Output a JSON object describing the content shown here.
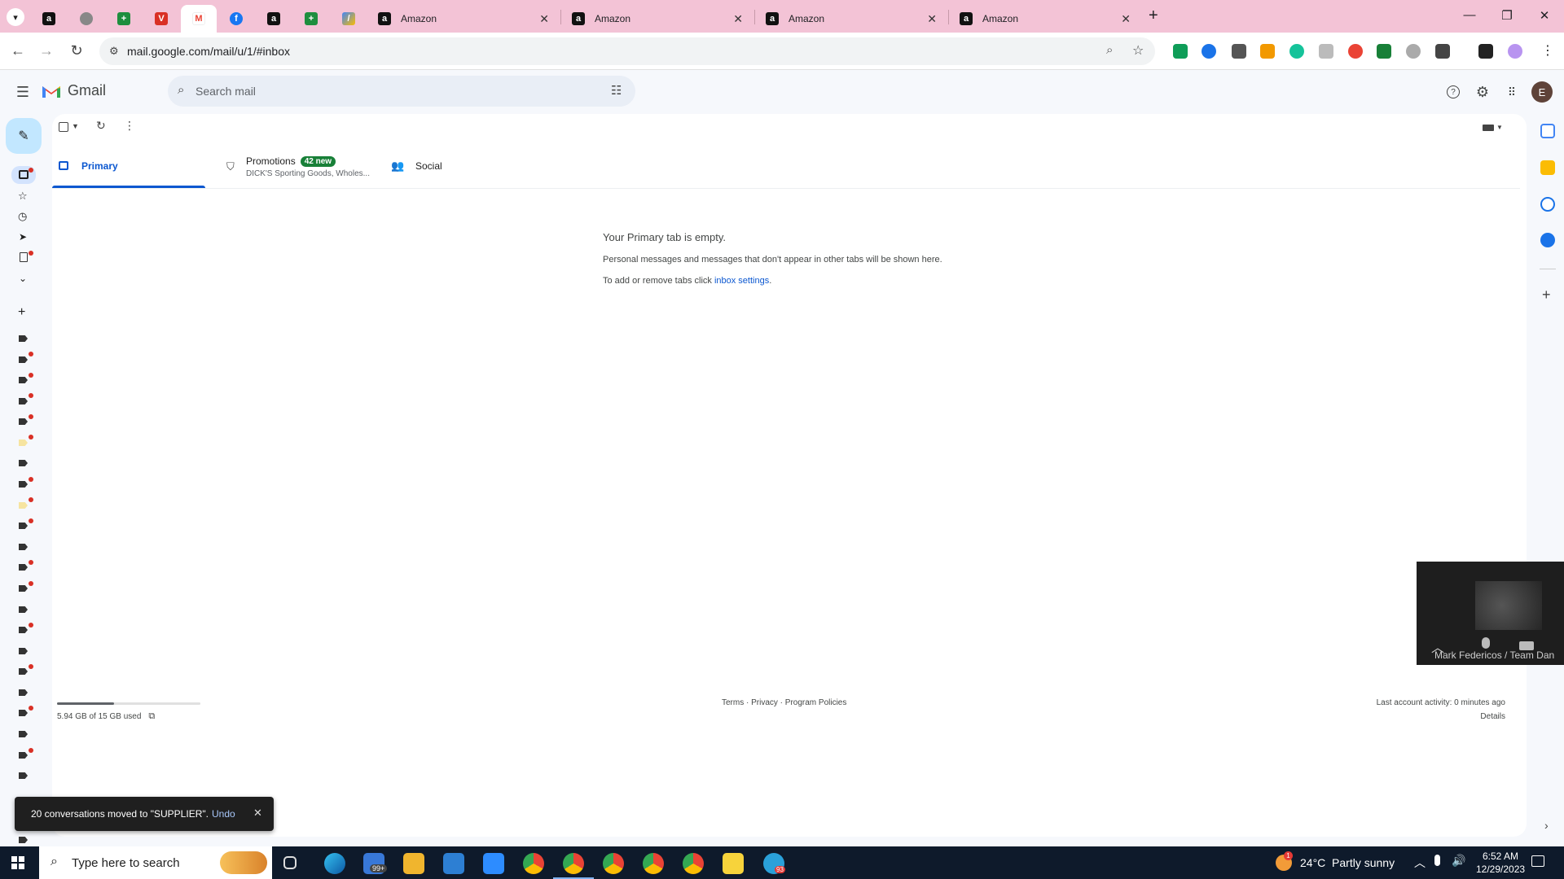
{
  "browser": {
    "tabs": [
      {
        "label": "Amazon"
      },
      {
        "label": "Amazon"
      },
      {
        "label": "Amazon"
      },
      {
        "label": "Amazon"
      }
    ],
    "url": "mail.google.com/mail/u/1/#inbox"
  },
  "header": {
    "app_name": "Gmail",
    "search_placeholder": "Search mail",
    "avatar_letter": "E"
  },
  "category_tabs": [
    {
      "label": "Primary"
    },
    {
      "label": "Promotions",
      "badge": "42 new",
      "snippet": "DICK'S Sporting Goods, Wholes..."
    },
    {
      "label": "Social"
    }
  ],
  "empty_state": {
    "title": "Your Primary tab is empty.",
    "line1": "Personal messages and messages that don't appear in other tabs will be shown here.",
    "line2_prefix": "To add or remove tabs click ",
    "line2_link": "inbox settings",
    "line2_suffix": "."
  },
  "footer": {
    "storage": "5.94 GB of 15 GB used",
    "storage_fraction": 0.396,
    "links": "Terms · Privacy · Program Policies",
    "activity": "Last account activity: 0 minutes ago",
    "details": "Details"
  },
  "video": {
    "participant": "Mark Federicos / Team Dan"
  },
  "toast": {
    "message": "20 conversations moved to \"SUPPLIER\".",
    "undo": "Undo"
  },
  "taskbar": {
    "search_placeholder": "Type here to search",
    "mail_badge": "99+",
    "telegram_badge": "93",
    "weather": "24°C  Partly sunny",
    "weather_badge": "1",
    "time": "6:52 AM",
    "date": "12/29/2023"
  },
  "colors": {
    "tabstrip": "#f3c3d6",
    "primary_blue": "#0b57d0",
    "compose": "#c2e7ff",
    "badge_green": "#188038",
    "taskbar": "#0e1a2b"
  }
}
